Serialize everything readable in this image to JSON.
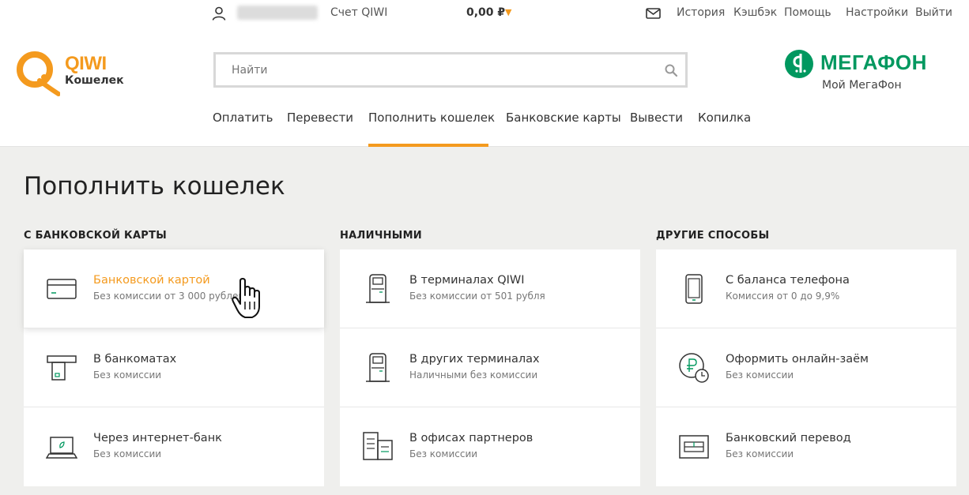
{
  "topbar": {
    "account_label": "Счет QIWI",
    "balance": "0,00 ₽",
    "links": [
      "История",
      "Кэшбэк",
      "Помощь",
      "Настройки",
      "Выйти"
    ]
  },
  "logo": {
    "brand": "QIWI",
    "sub": "Кошелек"
  },
  "search": {
    "placeholder": "Найти"
  },
  "partner": {
    "brand": "МЕГАФОН",
    "sub": "Мой МегаФон"
  },
  "nav": {
    "items": [
      "Оплатить",
      "Перевести",
      "Пополнить кошелек",
      "Банковские карты",
      "Вывести",
      "Копилка"
    ],
    "active": "Пополнить кошелек"
  },
  "page": {
    "title": "Пополнить кошелек"
  },
  "columns": [
    {
      "title": "С БАНКОВСКОЙ КАРТЫ",
      "cards": [
        {
          "title": "Банковской картой",
          "sub": "Без комиссии от 3 000 рублей",
          "icon": "bank-card-icon"
        },
        {
          "title": "В банкоматах",
          "sub": "Без комиссии",
          "icon": "atm-icon"
        },
        {
          "title": "Через интернет-банк",
          "sub": "Без комиссии",
          "icon": "laptop-icon"
        }
      ]
    },
    {
      "title": "НАЛИЧНЫМИ",
      "cards": [
        {
          "title": "В терминалах QIWI",
          "sub": "Без комиссии от 501 рубля",
          "icon": "terminal-icon"
        },
        {
          "title": "В других терминалах",
          "sub": "Наличными без комиссии",
          "icon": "terminal-icon"
        },
        {
          "title": "В офисах партнеров",
          "sub": "Без комиссии",
          "icon": "office-icon"
        }
      ]
    },
    {
      "title": "ДРУГИЕ СПОСОБЫ",
      "cards": [
        {
          "title": "С баланса телефона",
          "sub": "Комиссия от 0 до 9,9%",
          "icon": "phone-icon"
        },
        {
          "title": "Оформить онлайн-заём",
          "sub": "Без комиссии",
          "icon": "loan-clock-icon"
        },
        {
          "title": "Банковский перевод",
          "sub": "Без комиссии",
          "icon": "bank-transfer-icon"
        }
      ]
    }
  ],
  "colors": {
    "accent": "#f49a1e",
    "partner": "#00985f",
    "background": "#efefed"
  }
}
